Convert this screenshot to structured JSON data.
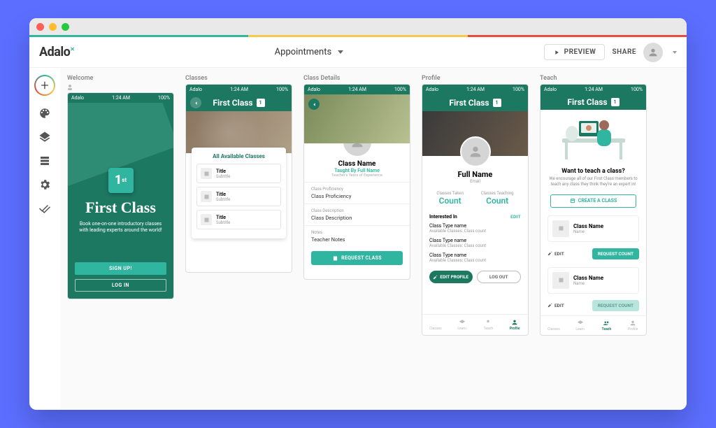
{
  "header": {
    "logo": "Adalo",
    "project": "Appointments",
    "preview": "PREVIEW",
    "share": "SHARE"
  },
  "stripe_colors": [
    "#2fb5a0",
    "#f7c948",
    "#e74c3c"
  ],
  "statusbar": {
    "carrier": "Adalo",
    "time": "1:24 AM",
    "battery": "100%"
  },
  "screens": {
    "welcome": {
      "label": "Welcome",
      "logo_mark": "1",
      "title": "First Class",
      "subtitle": "Book one-on-one introductory classes with leading experts around the world!",
      "signup": "SIGN UP!",
      "login": "LOG IN"
    },
    "classes": {
      "label": "Classes",
      "app_title": "First Class",
      "card_title": "All Available Classes",
      "items": [
        {
          "title": "Title",
          "subtitle": "Subtitle"
        },
        {
          "title": "Title",
          "subtitle": "Subtitle"
        },
        {
          "title": "Title",
          "subtitle": "Subtitle"
        }
      ]
    },
    "details": {
      "label": "Class Details",
      "class_name": "Class Name",
      "taught_by": "Taught By Full Name",
      "experience": "Teacher's Years of Experience",
      "sections": [
        {
          "label": "Class Proficiency",
          "value": "Class Proficiency"
        },
        {
          "label": "Class Description",
          "value": "Class Description"
        },
        {
          "label": "Notes",
          "value": "Teacher Notes"
        }
      ],
      "request": "REQUEST CLASS"
    },
    "profile": {
      "label": "Profile",
      "app_title": "First Class",
      "full_name": "Full Name",
      "email": "Email",
      "stats": [
        {
          "label": "Classes Taken",
          "count": "Count"
        },
        {
          "label": "Classes Teaching",
          "count": "Count"
        }
      ],
      "interested_label": "Interested In",
      "edit_label": "EDIT",
      "interests": [
        {
          "name": "Class Type name",
          "meta": "Available Classes: Class count"
        },
        {
          "name": "Class Type name",
          "meta": "Available Classes: Class count"
        },
        {
          "name": "Class Type name",
          "meta": "Available Classes: Class count"
        }
      ],
      "edit_profile": "EDIT PROFILE",
      "logout": "LOG OUT",
      "tabs": [
        "Classes",
        "Learn",
        "Teach",
        "Profile"
      ]
    },
    "teach": {
      "label": "Teach",
      "app_title": "First Class",
      "heading": "Want to teach a class?",
      "sub": "We encourage all of our First Class members to teach any class they think they're an expert in!",
      "create": "CREATE A CLASS",
      "items": [
        {
          "name": "Class Name",
          "teacher": "Name",
          "button": "REQUEST COUNT",
          "dim": false
        },
        {
          "name": "Class Name",
          "teacher": "Name",
          "button": "REQUEST COUNT",
          "dim": true
        }
      ],
      "edit": "EDIT",
      "tabs": [
        "Classes",
        "Learn",
        "Teach",
        "Profile"
      ]
    }
  }
}
